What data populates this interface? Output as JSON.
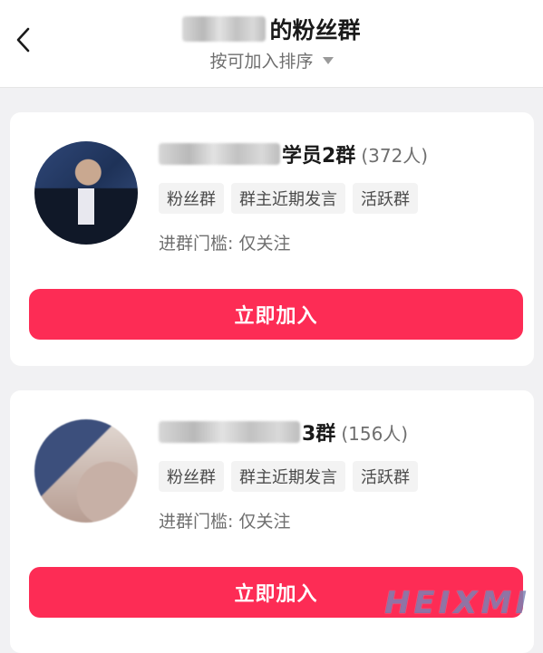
{
  "header": {
    "title_suffix": "的粉丝群",
    "sort_label": "按可加入排序"
  },
  "groups": [
    {
      "name_suffix": "学员2群",
      "member_count": "(372人)",
      "tags": [
        "粉丝群",
        "群主近期发言",
        "活跃群"
      ],
      "threshold": "进群门槛: 仅关注",
      "join_label": "立即加入"
    },
    {
      "name_suffix": "3群",
      "member_count": "(156人)",
      "tags": [
        "粉丝群",
        "群主近期发言",
        "活跃群"
      ],
      "threshold": "进群门槛: 仅关注",
      "join_label": "立即加入"
    }
  ],
  "watermark": "HEIXMI",
  "colors": {
    "accent": "#fd2c55",
    "background": "#f1f1f3"
  },
  "icons": {
    "back": "chevron-left-icon",
    "sort": "caret-down-icon"
  }
}
